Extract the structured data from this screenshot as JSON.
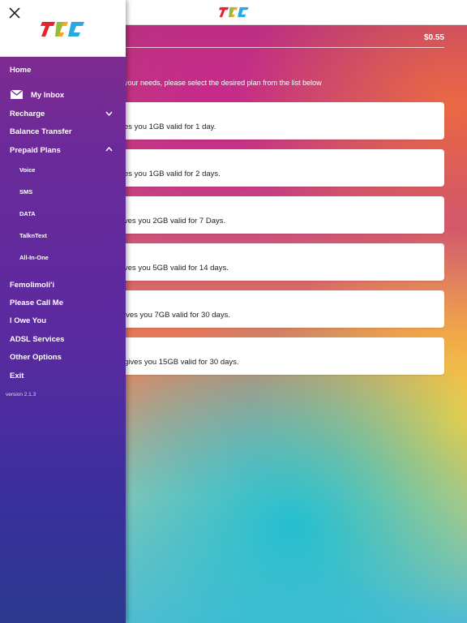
{
  "header": {
    "balance": "$0.55"
  },
  "intro_text": "your needs, please select the desired plan from the list below",
  "plans": [
    {
      "text": "es you 1GB valid for 1 day."
    },
    {
      "text": "es you 1GB valid for 2 days."
    },
    {
      "text": "ves you 2GB valid for 7 Days."
    },
    {
      "text": "ves you 5GB valid for 14 days."
    },
    {
      "text": "ives you 7GB valid for 30 days."
    },
    {
      "text": "gives you 15GB valid for 30 days."
    }
  ],
  "sidebar": {
    "home": "Home",
    "inbox": "My Inbox",
    "recharge": "Recharge",
    "balance_transfer": "Balance Transfer",
    "prepaid_plans": "Prepaid Plans",
    "sub_items": [
      "Voice",
      "SMS",
      "DATA",
      "TalknText",
      "All-In-One"
    ],
    "femolimoli": "Femolimoli'i",
    "please_call_me": "Please Call Me",
    "i_owe_you": "I Owe You",
    "adsl": "ADSL Services",
    "other_options": "Other Options",
    "exit": "Exit",
    "version": "version 2.1.3"
  },
  "icons": [
    "close-icon",
    "mail-icon",
    "chevron-down-icon",
    "chevron-up-icon",
    "logo"
  ],
  "colors": {
    "menu_bg": "#5a2aa0",
    "card_bg": "#ffffff"
  }
}
